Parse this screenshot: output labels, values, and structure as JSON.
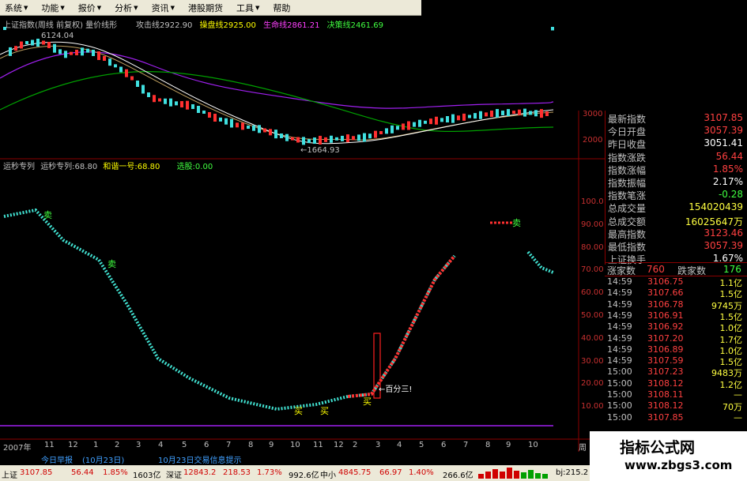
{
  "menu": [
    "系统",
    "功能",
    "报价",
    "分析",
    "资讯",
    "港股期货",
    "工具",
    "帮助"
  ],
  "chart": {
    "title": "上证指数(周线 前复权) 量价线形",
    "gongji_label": "攻击线",
    "gongji_value": "2922.90",
    "caopan_label": "操盘线",
    "caopan_value": "2925.00",
    "shengming_label": "生命线",
    "shengming_value": "2861.21",
    "juece_label": "决策线",
    "juece_value": "2461.69",
    "high_marker": "6124.04",
    "low_marker": "←1664.93",
    "upper_yaxis": [
      "3000",
      "2000"
    ],
    "lower_yaxis": [
      "100.0",
      "90.00",
      "80.00",
      "70.00",
      "60.00",
      "50.00",
      "40.00",
      "30.00",
      "20.00",
      "10.00"
    ],
    "xaxis": [
      "2007年",
      "11",
      "12",
      "1",
      "2",
      "3",
      "4",
      "5",
      "6",
      "7",
      "8",
      "9",
      "10",
      "11",
      "12",
      "2",
      "3",
      "4",
      "5",
      "6",
      "7",
      "8",
      "9",
      "10"
    ],
    "xaxis_right_label": "周",
    "ind_name": "运秒专列",
    "ind_series": "运秒专列:68.80",
    "ind_he": "和谐一号:68.80",
    "ind_xuanji": "选股:0.00",
    "marks": [
      "买",
      "买",
      "买",
      "卖"
    ],
    "annotation": "←百分三!"
  },
  "quote": {
    "rows": [
      {
        "label": "最新指数",
        "value": "3107.85",
        "color": "#ff4040"
      },
      {
        "label": "今日开盘",
        "value": "3057.39",
        "color": "#ff4040"
      },
      {
        "label": "昨日收盘",
        "value": "3051.41",
        "color": "#ffffff"
      },
      {
        "label": "指数涨跌",
        "value": "56.44",
        "color": "#ff4040"
      },
      {
        "label": "指数涨幅",
        "value": "1.85%",
        "color": "#ff4040"
      },
      {
        "label": "指数振幅",
        "value": "2.17%",
        "color": "#ffffff"
      },
      {
        "label": "指数笔涨",
        "value": "-0.28",
        "color": "#40ff40"
      },
      {
        "label": "总成交量",
        "value": "154020439",
        "color": "#ffff40"
      },
      {
        "label": "总成交额",
        "value": "16025647万",
        "color": "#ffff40"
      },
      {
        "label": "最高指数",
        "value": "3123.46",
        "color": "#ff4040"
      },
      {
        "label": "最低指数",
        "value": "3057.39",
        "color": "#ff4040"
      },
      {
        "label": "上证换手",
        "value": "1.67%",
        "color": "#ffffff"
      }
    ],
    "up_label": "涨家数",
    "up_value": "760",
    "down_label": "跌家数",
    "down_value": "176"
  },
  "ticks": [
    {
      "time": "14:59",
      "price": "3106.75",
      "vol": "1.1亿"
    },
    {
      "time": "14:59",
      "price": "3107.66",
      "vol": "1.5亿"
    },
    {
      "time": "14:59",
      "price": "3106.78",
      "vol": "9745万"
    },
    {
      "time": "14:59",
      "price": "3106.91",
      "vol": "1.5亿"
    },
    {
      "time": "14:59",
      "price": "3106.92",
      "vol": "1.0亿"
    },
    {
      "time": "14:59",
      "price": "3107.20",
      "vol": "1.7亿"
    },
    {
      "time": "14:59",
      "price": "3106.89",
      "vol": "1.0亿"
    },
    {
      "time": "14:59",
      "price": "3107.59",
      "vol": "1.5亿"
    },
    {
      "time": "15:00",
      "price": "3107.23",
      "vol": "9483万"
    },
    {
      "time": "15:00",
      "price": "3108.12",
      "vol": "1.2亿"
    },
    {
      "time": "15:00",
      "price": "3108.11",
      "vol": "—"
    },
    {
      "time": "15:00",
      "price": "3108.12",
      "vol": "70万"
    },
    {
      "time": "15:00",
      "price": "3107.85",
      "vol": "—"
    }
  ],
  "tabs": {
    "t1": "今日早报",
    "t2": "(10月23日)",
    "t3": "10月23日交易信息提示"
  },
  "status": {
    "sh_label": "上证",
    "sh_value": "3107.85",
    "sh_chg": "56.44",
    "sh_pct": "1.85%",
    "sh_amt": "1603亿",
    "sz_label": "深证",
    "sz_value": "12843.2",
    "sz_chg": "218.53",
    "sz_pct": "1.73%",
    "sz_amt": "992.6亿",
    "zx_label": "中小",
    "zx_value": "4845.75",
    "zx_chg": "66.97",
    "zx_pct": "1.40%",
    "zx_amt": "266.6亿",
    "conn": "bj:215.2"
  },
  "watermark": {
    "title": "指标公式网",
    "url": "www.zbgs3.com"
  }
}
